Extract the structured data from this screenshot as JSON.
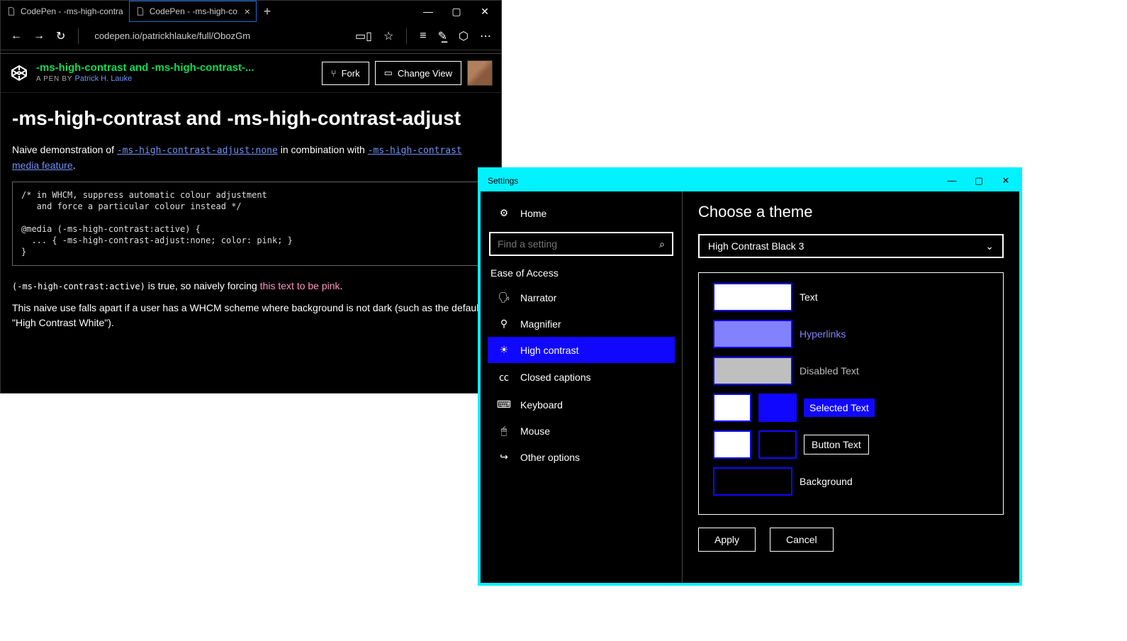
{
  "browser": {
    "tabs": [
      {
        "label": "CodePen - -ms-high-contra",
        "active": false
      },
      {
        "label": "CodePen - -ms-high-co",
        "active": true
      }
    ],
    "url": "codepen.io/patrickhlauke/full/ObozGm",
    "codepen": {
      "title": "-ms-high-contrast and -ms-high-contrast-...",
      "byline_prefix": "A PEN BY ",
      "author": "Patrick H. Lauke",
      "fork_label": "Fork",
      "change_view_label": "Change View"
    },
    "page": {
      "heading": "-ms-high-contrast and -ms-high-contrast-adjust",
      "intro_pre": "Naive demonstration of ",
      "intro_link1": "-ms-high-contrast-adjust:none",
      "intro_mid": " in combination with ",
      "intro_link2": "-ms-high-contrast",
      "intro_link3": " media feature",
      "intro_post": ".",
      "code": "/* in WHCM, suppress automatic colour adjustment\n   and force a particular colour instead */\n\n@media (-ms-high-contrast:active) {\n  ... { -ms-high-contrast-adjust:none; color: pink; }\n}",
      "after_code_pre": "(-ms-high-contrast:active)",
      "after_code_mid": " is true, so naively forcing ",
      "after_code_pink": "this text to be pink",
      "after_code_post": ".",
      "para2": "This naive use falls apart if a user has a WHCM scheme where background is not dark (such as the default \"High Contrast White\")."
    }
  },
  "settings": {
    "title": "Settings",
    "sidebar": {
      "home_label": "Home",
      "search_placeholder": "Find a setting",
      "category": "Ease of Access",
      "items": [
        {
          "icon": "narrator",
          "label": "Narrator"
        },
        {
          "icon": "magnifier",
          "label": "Magnifier"
        },
        {
          "icon": "high-contrast",
          "label": "High contrast",
          "active": true
        },
        {
          "icon": "closed-captions",
          "label": "Closed captions"
        },
        {
          "icon": "keyboard",
          "label": "Keyboard"
        },
        {
          "icon": "mouse",
          "label": "Mouse"
        },
        {
          "icon": "other",
          "label": "Other options"
        }
      ]
    },
    "main": {
      "heading": "Choose a theme",
      "theme_selected": "High Contrast Black 3",
      "colors": {
        "text": {
          "swatch": "#ffffff",
          "label": "Text"
        },
        "hyperlinks": {
          "swatch": "#8282ff",
          "label": "Hyperlinks"
        },
        "disabled": {
          "swatch": "#bfbfbf",
          "label": "Disabled Text"
        },
        "selected": {
          "fg": "#ffffff",
          "bg": "#1007ff",
          "label": "Selected Text"
        },
        "button": {
          "fg": "#ffffff",
          "bg": "#000000",
          "label": "Button Text"
        },
        "background": {
          "swatch": "#000000",
          "label": "Background"
        }
      },
      "apply_label": "Apply",
      "cancel_label": "Cancel"
    }
  }
}
